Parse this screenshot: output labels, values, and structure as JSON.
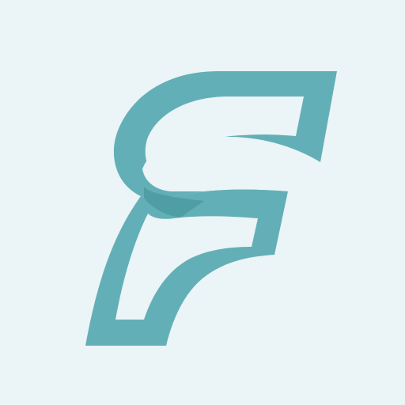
{
  "logo": {
    "icon": "stylized-letter-f-icon",
    "colors": {
      "background": "#ebf4f6",
      "stroke": "#63afb7",
      "overlap": "#4e9ea3"
    }
  }
}
